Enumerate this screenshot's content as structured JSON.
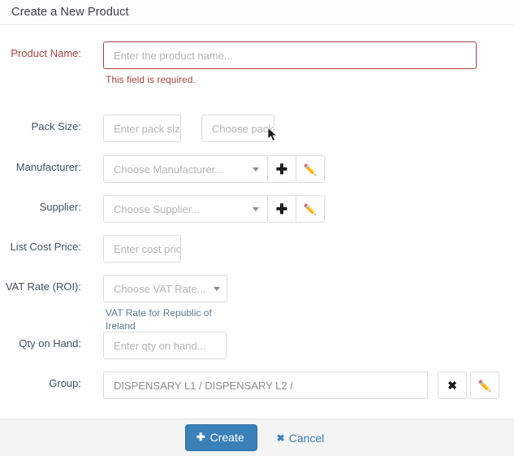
{
  "header": {
    "title": "Create a New Product"
  },
  "form": {
    "product_name": {
      "label": "Product Name:",
      "placeholder": "Enter the product name...",
      "value": "",
      "error": "This field is required.",
      "error_color": "#a94442"
    },
    "pack_size": {
      "label": "Pack Size:",
      "qty_placeholder": "Enter pack size...",
      "unit_placeholder": "Choose pack unit...",
      "qty_value": "",
      "unit_value": ""
    },
    "manufacturer": {
      "label": "Manufacturer:",
      "placeholder": "Choose Manufacturer...",
      "value": "",
      "add_icon": "plus-icon",
      "edit_icon": "pencil-icon"
    },
    "supplier": {
      "label": "Supplier:",
      "placeholder": "Choose Supplier...",
      "value": "",
      "add_icon": "plus-icon",
      "edit_icon": "pencil-icon"
    },
    "list_cost_price": {
      "label": "List Cost Price:",
      "placeholder": "Enter cost price...",
      "value": ""
    },
    "vat_rate": {
      "label": "VAT Rate (ROI):",
      "placeholder": "Choose VAT Rate...",
      "value": "",
      "help": "VAT Rate for Republic of Ireland"
    },
    "qty_on_hand": {
      "label": "Qty on Hand:",
      "placeholder": "Enter qty on hand...",
      "value": ""
    },
    "group": {
      "label": "Group:",
      "value": "DISPENSARY L1 /  DISPENSARY L2 /",
      "clear_icon": "close-x-icon",
      "edit_icon": "pencil-icon"
    }
  },
  "footer": {
    "create_label": "Create",
    "create_icon": "plus-icon",
    "create_color": "#3a80b9",
    "cancel_label": "Cancel",
    "cancel_icon": "close-x-icon"
  },
  "icons": {
    "plus": "✚",
    "pencil": "✏️",
    "x": "✖"
  }
}
